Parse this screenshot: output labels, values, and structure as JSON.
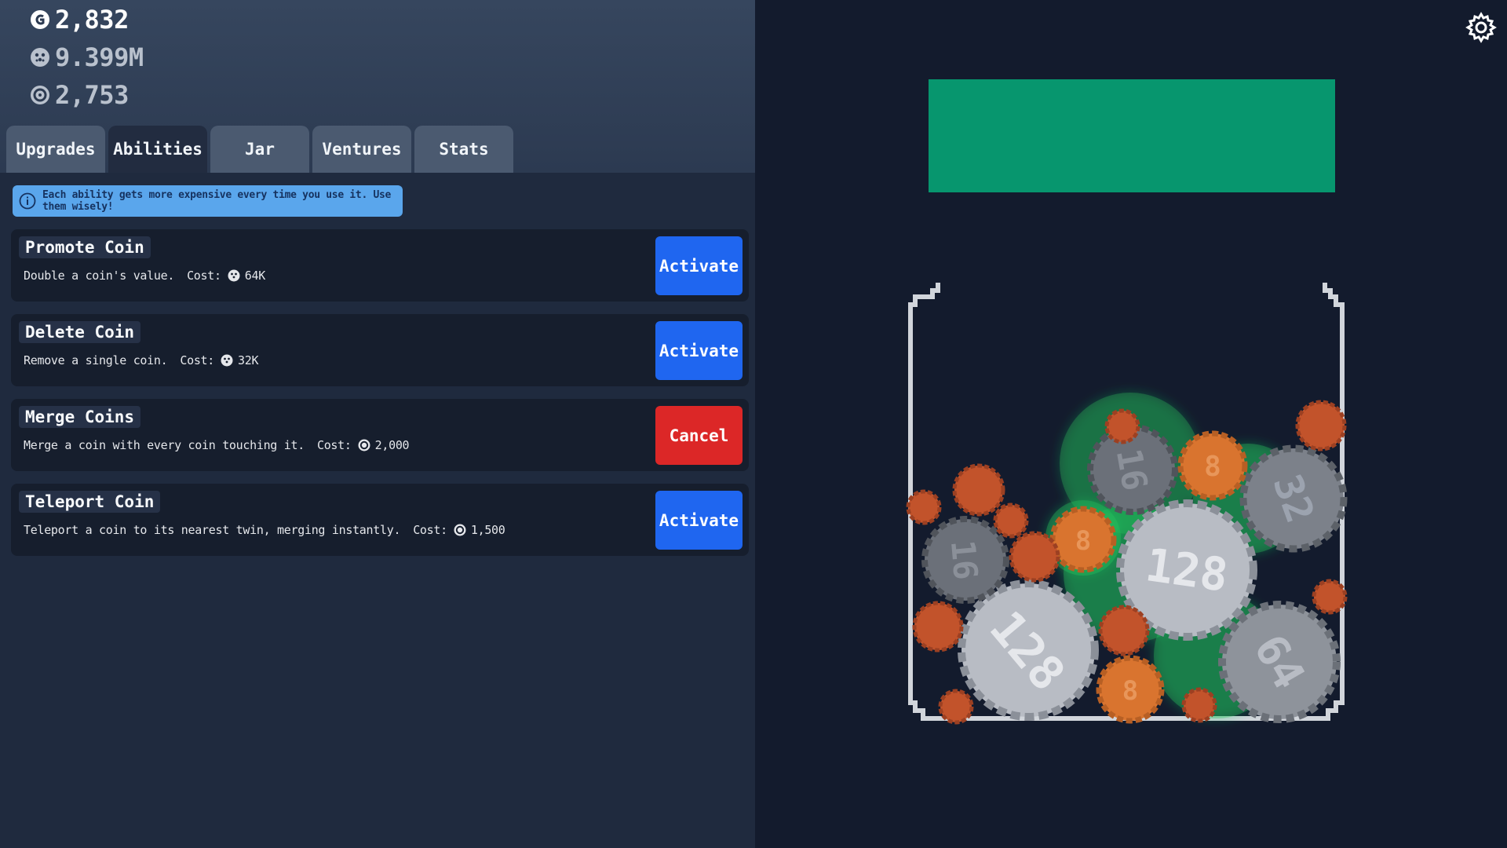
{
  "currencies": {
    "gold": "2,832",
    "pink": "9.399M",
    "silver": "2,753"
  },
  "tabs": [
    {
      "label": "Upgrades",
      "active": false
    },
    {
      "label": "Abilities",
      "active": true
    },
    {
      "label": "Jar",
      "active": false
    },
    {
      "label": "Ventures",
      "active": false
    },
    {
      "label": "Stats",
      "active": false
    }
  ],
  "info_banner": "Each ability gets more expensive every time you use it. Use them wisely!",
  "abilities": [
    {
      "title": "Promote Coin",
      "description": "Double a coin's value.",
      "cost_label": "Cost:",
      "cost_icon": "pink-coin-icon",
      "cost": "64K",
      "button": "Activate",
      "button_color": "#1f66f0"
    },
    {
      "title": "Delete Coin",
      "description": "Remove a single coin.",
      "cost_label": "Cost:",
      "cost_icon": "pink-coin-icon",
      "cost": "32K",
      "button": "Activate",
      "button_color": "#1f66f0"
    },
    {
      "title": "Merge Coins",
      "description": "Merge a coin with every coin touching it.",
      "cost_label": "Cost:",
      "cost_icon": "silver-coin-icon",
      "cost": "2,000",
      "button": "Cancel",
      "button_color": "#dc2727"
    },
    {
      "title": "Teleport Coin",
      "description": "Teleport a coin to its nearest twin, merging instantly.",
      "cost_label": "Cost:",
      "cost_icon": "silver-coin-icon",
      "cost": "1,500",
      "button": "Activate",
      "button_color": "#1f66f0"
    }
  ],
  "coin_labels": [
    "128",
    "128",
    "64",
    "32",
    "16",
    "16",
    "8",
    "8",
    "8"
  ],
  "colors": {
    "drop_zone": "#07966e",
    "glow": "#22c55e",
    "copper_coin": "#c2532b",
    "bronze_coin": "#d9742f",
    "silver_coin": "#9ca3af"
  }
}
